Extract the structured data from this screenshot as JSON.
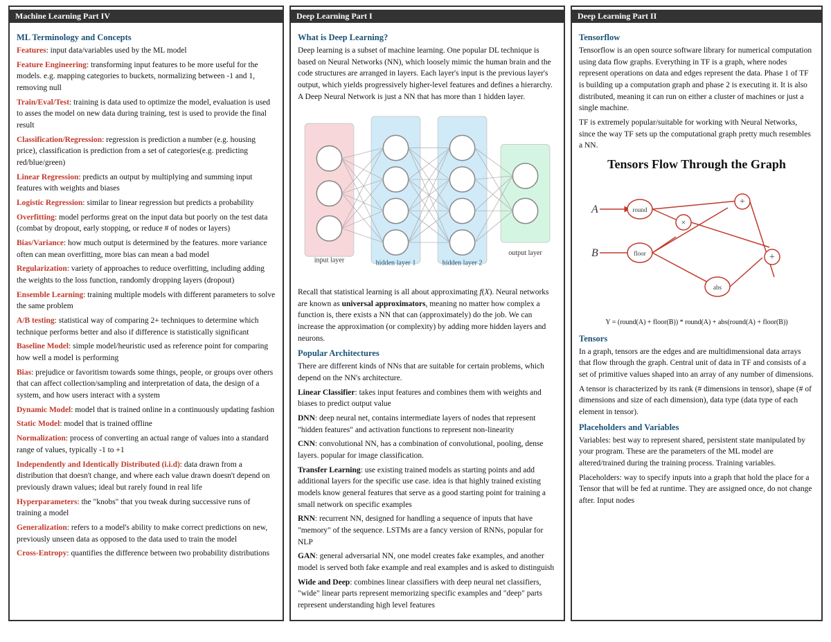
{
  "panels": {
    "panel1": {
      "title": "Machine Learning Part IV",
      "heading1": "ML Terminology and Concepts",
      "terms": [
        {
          "term": "Features",
          "def": ": input data/variables used by the ML model"
        },
        {
          "term": "Feature Engineering",
          "def": ": transforming input features to be more useful for the models. e.g. mapping categories to buckets, normalizing between -1 and 1, removing null"
        },
        {
          "term": "Train/Eval/Test",
          "def": ": training is data used to optimize the model, evaluation is used to asses the model on new data during training, test is used to provide the final result"
        },
        {
          "term": "Classification/Regression",
          "def": ": regression is prediction a number (e.g. housing price), classification is prediction from a set of categories(e.g. predicting red/blue/green)"
        },
        {
          "term": "Linear Regression",
          "def": ": predicts an output by multiplying and summing input features with weights and biases"
        },
        {
          "term": "Logistic Regression",
          "def": ": similar to linear regression but predicts a probability"
        },
        {
          "term": "Overfitting",
          "def": ": model performs great on the input data but poorly on the test data (combat by dropout, early stopping, or reduce # of nodes or layers)"
        },
        {
          "term": "Bias/Variance",
          "def": ": how much output is determined by the features. more variance often can mean overfitting, more bias can mean a bad model"
        },
        {
          "term": "Regularization",
          "def": ": variety of approaches to reduce overfitting, including adding the weights to the loss function, randomly dropping layers (dropout)"
        },
        {
          "term": "Ensemble Learning",
          "def": ": training multiple models with different parameters to solve the same problem"
        },
        {
          "term": "A/B testing",
          "def": ": statistical way of comparing 2+ techniques to determine which technique performs better and also if difference is statistically significant"
        },
        {
          "term": "Baseline Model",
          "def": ": simple model/heuristic used as reference point for comparing how well a model is performing"
        },
        {
          "term": "Bias",
          "def": ": prejudice or favoritism towards some things, people, or groups over others that can affect collection/sampling and interpretation of data, the design of a system, and how users interact with a system"
        },
        {
          "term": "Dynamic Model",
          "def": ": model that is trained online in a continuously updating fashion"
        },
        {
          "term": "Static Model",
          "def": ": model that is trained offline"
        },
        {
          "term": "Normalization",
          "def": ": process of converting an actual range of values into a standard range of values, typically -1 to +1"
        },
        {
          "term": "Independently and Identically Distributed (i.i.d)",
          "def": ": data drawn from a distribution that doesn't change, and where each value drawn doesn't depend on previously drawn values; ideal but rarely found in real life"
        },
        {
          "term": "Hyperparameters",
          "def": ": the \"knobs\" that you tweak during successive runs of training a model"
        },
        {
          "term": "Generalization",
          "def": ": refers to a model's ability to make correct predictions on new, previously unseen data as opposed to the data used to train the model"
        },
        {
          "term": "Cross-Entropy",
          "def": ": quantifies the difference between two probability distributions"
        }
      ]
    },
    "panel2": {
      "title": "Deep Learning Part I",
      "heading1": "What is Deep Learning?",
      "intro": "Deep learning is a subset of machine learning. One popular DL technique is based on Neural Networks (NN), which loosely mimic the human brain and the code structures are arranged in layers. Each layer's input is the previous layer's output, which yields progressively higher-level features and defines a hierarchy. A Deep Neural Network is just a NN that has more than 1 hidden layer.",
      "nn_labels": {
        "input": "input layer",
        "hidden1": "hidden layer 1",
        "hidden2": "hidden layer 2",
        "output": "output layer"
      },
      "recall_text": "Recall that statistical learning is all about approximating f(X). Neural networks are known as universal approximators, meaning no matter how complex a function is, there exists a NN that can (approximately) do the job. We can increase the approximation (or complexity) by adding more hidden layers and neurons.",
      "heading2": "Popular Architectures",
      "arch_intro": "There are different kinds of NNs that are suitable for certain problems, which depend on the NN's architecture.",
      "architectures": [
        {
          "name": "Linear Classifier",
          "def": ": takes input features and combines them with weights and biases to predict output value"
        },
        {
          "name": "DNN",
          "def": ": deep neural net, contains intermediate layers of nodes that represent \"hidden features\" and activation functions to represent non-linearity"
        },
        {
          "name": "CNN",
          "def": ": convolutional NN, has a combination of convolutional, pooling, dense layers. popular for image classification."
        },
        {
          "name": "Transfer Learning",
          "def": ": use existing trained models as starting points and add additional layers for the specific use case. idea is that highly trained existing models know general features that serve as a good starting point for training a small network on specific examples"
        },
        {
          "name": "RNN",
          "def": ": recurrent NN, designed for handling a sequence of inputs that have \"memory\" of the sequence. LSTMs are a fancy version of RNNs, popular for NLP"
        },
        {
          "name": "GAN",
          "def": ": general adversarial NN, one model creates fake examples, and another model is served both fake example and real examples and is asked to distinguish"
        },
        {
          "name": "Wide and Deep",
          "def": ": combines linear classifiers with deep neural net classifiers, \"wide\" linear parts represent memorizing specific examples and \"deep\" parts represent understanding high level features"
        }
      ]
    },
    "panel3": {
      "title": "Deep Learning Part II",
      "heading1": "Tensorflow",
      "tf_text1": "Tensorflow is an open source software library for numerical computation using data flow graphs. Everything in TF is a graph, where nodes represent operations on data and edges represent the data. Phase 1 of TF is building up a computation graph and phase 2 is executing it. It is also distributed, meaning it can run on either a cluster of machines or just a single machine.",
      "tf_text2": "TF is extremely popular/suitable for working with Neural Networks, since the way TF sets up the computational graph pretty much resembles a NN.",
      "graph_title": "Tensors Flow Through the Graph",
      "equation": "Y = (round(A) + floor(B)) * round(A) + abs(round(A) + floor(B))",
      "heading2": "Tensors",
      "tensors_text1": "In a graph, tensors are the edges and are multidimensional data arrays that flow through the graph. Central unit of data in TF and consists of a set of primitive values shaped into an array of any number of dimensions.",
      "tensors_text2": "A tensor is characterized by its rank (# dimensions in tensor), shape (# of dimensions and size of each dimension), data type (data type of each element in tensor).",
      "heading3": "Placeholders and Variables",
      "variables_text": "Variables: best way to represent shared, persistent state manipulated by your program. These are the parameters of the ML model are altered/trained during the training process. Training variables.",
      "placeholders_text": "Placeholders: way to specify inputs into a graph that hold the place for a Tensor that will be fed at runtime. They are assigned once, do not change after. Input nodes"
    }
  }
}
